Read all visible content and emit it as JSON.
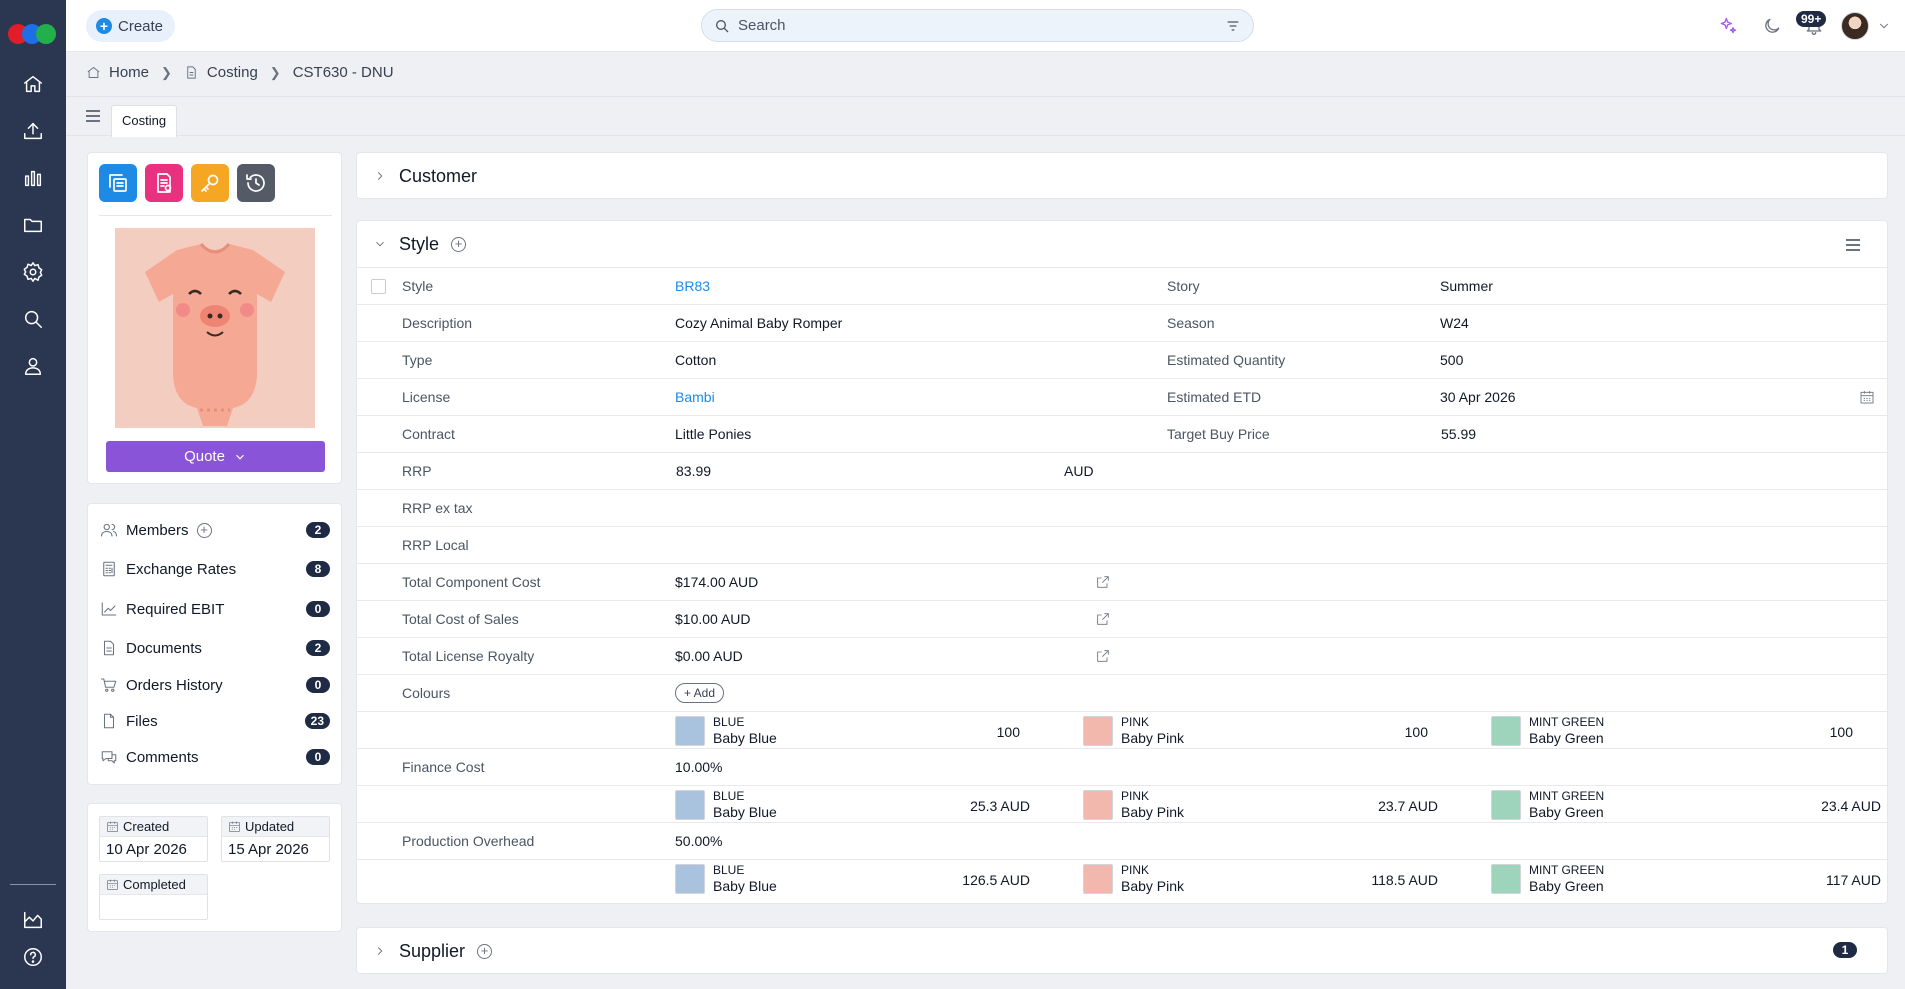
{
  "topbar": {
    "create_label": "Create",
    "search_placeholder": "Search",
    "notif_count": "99+"
  },
  "breadcrumb": [
    "Home",
    "Costing",
    "CST630 - DNU"
  ],
  "tabs": [
    "Costing"
  ],
  "left_panel": {
    "quote_label": "Quote",
    "items": [
      {
        "label": "Members",
        "count": "2"
      },
      {
        "label": "Exchange Rates",
        "count": "8"
      },
      {
        "label": "Required EBIT",
        "count": "0"
      },
      {
        "label": "Documents",
        "count": "2"
      },
      {
        "label": "Orders History",
        "count": "0"
      },
      {
        "label": "Files",
        "count": "23"
      },
      {
        "label": "Comments",
        "count": "0"
      }
    ],
    "dates": {
      "created_label": "Created",
      "created_value": "10 Apr 2026",
      "updated_label": "Updated",
      "updated_value": "15 Apr 2026",
      "completed_label": "Completed",
      "completed_value": ""
    }
  },
  "sections": {
    "customer": "Customer",
    "style": "Style",
    "supplier": "Supplier",
    "supplier_count": "1"
  },
  "style": {
    "style_label": "Style",
    "style_value": "BR83",
    "story_label": "Story",
    "story_value": "Summer",
    "description_label": "Description",
    "description_value": "Cozy Animal Baby Romper",
    "season_label": "Season",
    "season_value": "W24",
    "type_label": "Type",
    "type_value": "Cotton",
    "est_qty_label": "Estimated Quantity",
    "est_qty_value": "500",
    "license_label": "License",
    "license_value": "Bambi",
    "est_etd_label": "Estimated ETD",
    "est_etd_value": "30 Apr 2026",
    "contract_label": "Contract",
    "contract_value": "Little Ponies",
    "target_price_label": "Target Buy Price",
    "target_price_value": "55.99",
    "rrp_label": "RRP",
    "rrp_value": "83.99",
    "rrp_currency": "AUD",
    "rrp_ex_tax_label": "RRP ex tax",
    "rrp_local_label": "RRP Local",
    "total_component_label": "Total Component Cost",
    "total_component_value": "$174.00 AUD",
    "total_sales_label": "Total Cost of Sales",
    "total_sales_value": "$10.00 AUD",
    "total_royalty_label": "Total License Royalty",
    "total_royalty_value": "$0.00 AUD",
    "colours_label": "Colours",
    "add_label": "+ Add",
    "finance_label": "Finance Cost",
    "finance_value": "10.00%",
    "overhead_label": "Production Overhead",
    "overhead_value": "50.00%"
  },
  "colours": [
    {
      "code": "BLUE",
      "name": "Baby Blue",
      "color": "#a9c3de",
      "qty": "100",
      "finance": "25.3 AUD",
      "overhead": "126.5 AUD"
    },
    {
      "code": "PINK",
      "name": "Baby Pink",
      "color": "#f2b7ad",
      "qty": "100",
      "finance": "23.7 AUD",
      "overhead": "118.5 AUD"
    },
    {
      "code": "MINT GREEN",
      "name": "Baby Green",
      "color": "#9ed4bc",
      "qty": "100",
      "finance": "23.4 AUD",
      "overhead": "117 AUD"
    }
  ]
}
